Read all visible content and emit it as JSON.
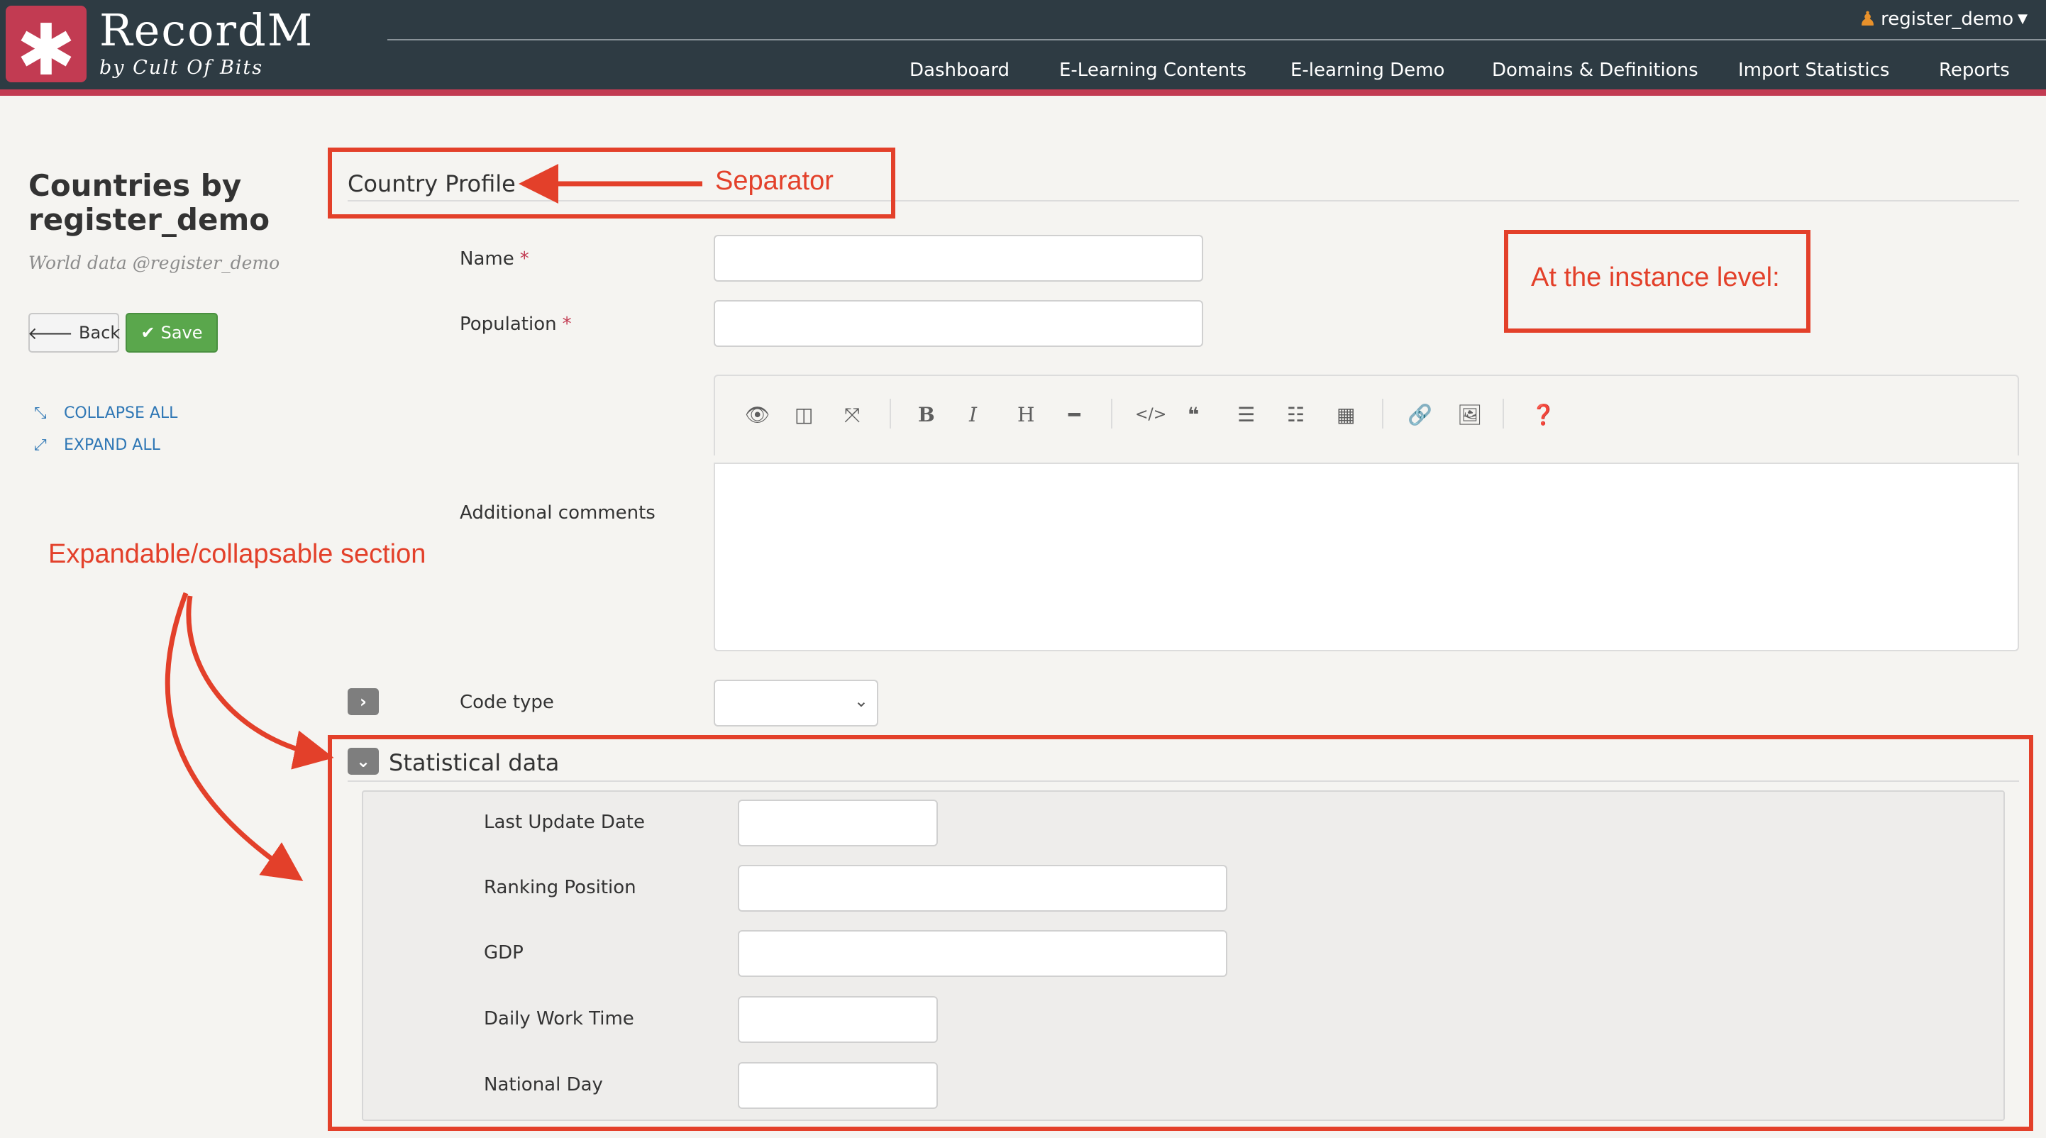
{
  "app": {
    "name": "RecordM",
    "tagline": "by Cult Of Bits",
    "logo_icon": "asterisk-icon"
  },
  "header": {
    "user": "register_demo",
    "nav": [
      "Dashboard",
      "E-Learning Contents",
      "E-learning Demo",
      "Domains & Definitions",
      "Import Statistics",
      "Reports"
    ]
  },
  "sidebar": {
    "title": "Countries by register_demo",
    "subtitle": "World data @register_demo",
    "back_label": "Back",
    "save_label": "Save",
    "collapse_all": "COLLAPSE ALL",
    "expand_all": "EXPAND ALL"
  },
  "form": {
    "separator_title": "Country Profile",
    "name_label": "Name",
    "population_label": "Population",
    "required_mark": "*",
    "comments_label": "Additional comments",
    "code_type_label": "Code type",
    "code_type_value": "",
    "editor_toolbar": [
      "eye-icon",
      "columns-icon",
      "fullscreen-icon",
      "B",
      "I",
      "H",
      "horizontal-rule-icon",
      "code-icon",
      "quote-icon",
      "bullet-list-icon",
      "numbered-list-icon",
      "table-icon",
      "link-icon",
      "image-icon",
      "help-icon"
    ],
    "section": {
      "title": "Statistical data",
      "fields": [
        "Last Update Date",
        "Ranking Position",
        "GDP",
        "Daily Work Time",
        "National Day"
      ]
    }
  },
  "annotations": {
    "separator": "Separator",
    "instance_level": "At the instance level:",
    "expandable": "Expandable/collapsable section",
    "color": "#e3402a"
  },
  "colors": {
    "header_bg": "#2e3b43",
    "brand_accent": "#c23b52",
    "save_green": "#5aa74c",
    "link_blue": "#2f77b5"
  }
}
